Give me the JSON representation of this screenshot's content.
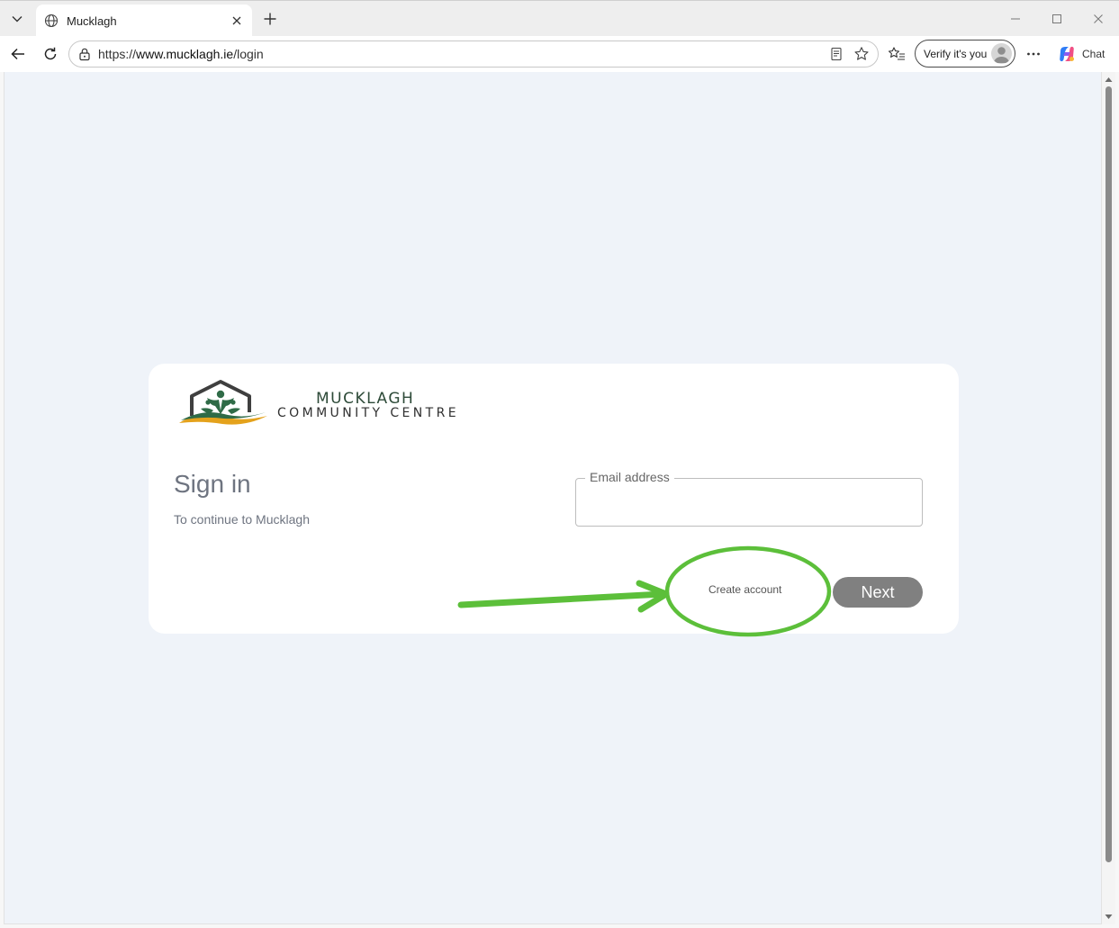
{
  "browser": {
    "tab": {
      "title": "Mucklagh"
    },
    "address": {
      "url_prefix": "https://",
      "url_host": "www.mucklagh.ie",
      "url_path": "/login"
    },
    "verify_label": "Verify it's you",
    "chat_label": "Chat"
  },
  "page": {
    "logo": {
      "line1": "MUCKLAGH",
      "line2": "COMMUNITY CENTRE"
    },
    "signin": {
      "title": "Sign in",
      "subtitle": "To continue to Mucklagh",
      "email_label": "Email address",
      "email_value": "",
      "create_account": "Create account",
      "next": "Next"
    }
  },
  "colors": {
    "annotation": "#5cbf3a",
    "next_button": "#808080",
    "page_background": "#eff3f9"
  }
}
